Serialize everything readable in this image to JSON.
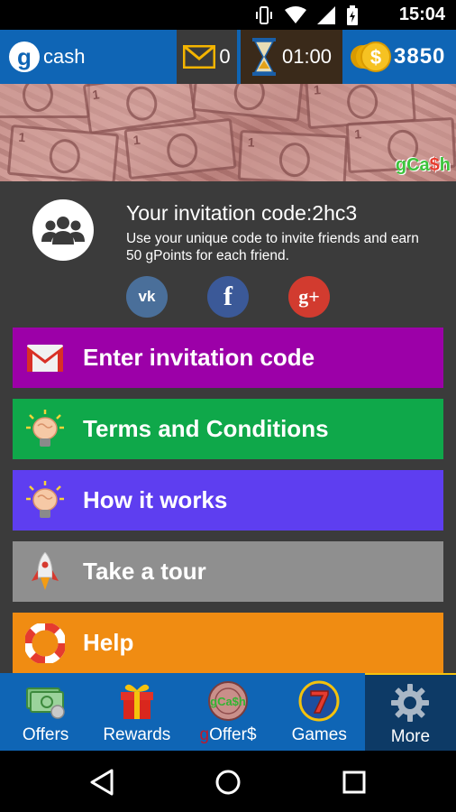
{
  "status_bar": {
    "time": "15:04"
  },
  "app_bar": {
    "brand_letter": "g",
    "brand_text": "cash",
    "messages_count": "0",
    "timer": "01:00",
    "coins": "3850",
    "coin_symbol": "$"
  },
  "banner": {
    "logo_g": "gCa",
    "logo_dollar": "$",
    "logo_h": "h",
    "bill_numbers": [
      "1",
      "1",
      "1",
      "1",
      "1",
      "1",
      "1",
      "1"
    ]
  },
  "invite": {
    "title": "Your invitation code:2hc3",
    "description": "Use your unique code to invite friends and earn 50 gPoints for each friend.",
    "social": [
      {
        "name": "vk",
        "glyph": "vk"
      },
      {
        "name": "facebook",
        "glyph": "f"
      },
      {
        "name": "google-plus",
        "glyph": "g+"
      }
    ]
  },
  "menu": [
    {
      "label": "Enter invitation code",
      "color": "#9c00a8",
      "icon": "gmail-icon"
    },
    {
      "label": "Terms and Conditions",
      "color": "#0fa84a",
      "icon": "brain-bulb-icon"
    },
    {
      "label": "How it works",
      "color": "#5e3ef0",
      "icon": "brain-bulb-icon"
    },
    {
      "label": "Take a tour",
      "color": "#8f8f8f",
      "icon": "rocket-icon"
    },
    {
      "label": "Help",
      "color": "#f08c12",
      "icon": "lifebuoy-icon"
    }
  ],
  "bottom_nav": {
    "items": [
      {
        "label": "Offers",
        "icon": "money-icon"
      },
      {
        "label": "Rewards",
        "icon": "gift-icon"
      },
      {
        "label_g": "g",
        "label_rest": "Offer$",
        "icon": "gcash-badge-icon"
      },
      {
        "label": "Games",
        "icon": "slot-seven-icon"
      },
      {
        "label": "More",
        "icon": "gear-icon",
        "active": true
      }
    ]
  },
  "colors": {
    "appbar": "#0f65b5",
    "content_bg": "#3b3b3b",
    "active_nav": "#0d3a66"
  }
}
